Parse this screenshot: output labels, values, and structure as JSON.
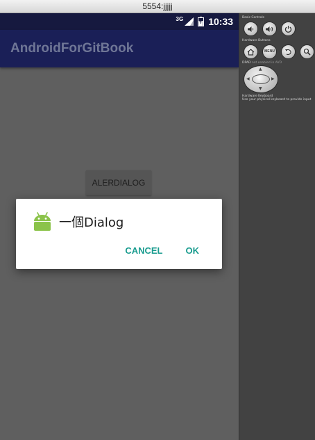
{
  "window": {
    "title": "5554:jjjjj"
  },
  "statusbar": {
    "network": "3G",
    "time": "10:33"
  },
  "appbar": {
    "title": "AndroidForGitBook"
  },
  "main": {
    "button_label": "ALERDIALOG"
  },
  "dialog": {
    "title": "一個Dialog",
    "icon": "android-robot-icon",
    "cancel_label": "CANCEL",
    "ok_label": "OK",
    "accent_color": "#1a9c8f"
  },
  "controls": {
    "basic_controls_label": "Basic Controls",
    "hardware_buttons_label": "Hardware Buttons",
    "dpad_label": "DPAD",
    "dpad_note": "not enabled in AVD",
    "keyboard_label": "Hardware Keyboard",
    "keyboard_note": "Use your physical keyboard to provide input",
    "basic_buttons": [
      "volume-down-icon",
      "volume-up-icon",
      "power-icon"
    ],
    "hardware_buttons": [
      "home-icon",
      "MENU",
      "back-icon",
      "search-icon"
    ]
  },
  "colors": {
    "statusbar": "#16193f",
    "appbar": "#1a1f57",
    "screen_background": "#5f5f5f",
    "panel_background": "#424242"
  }
}
